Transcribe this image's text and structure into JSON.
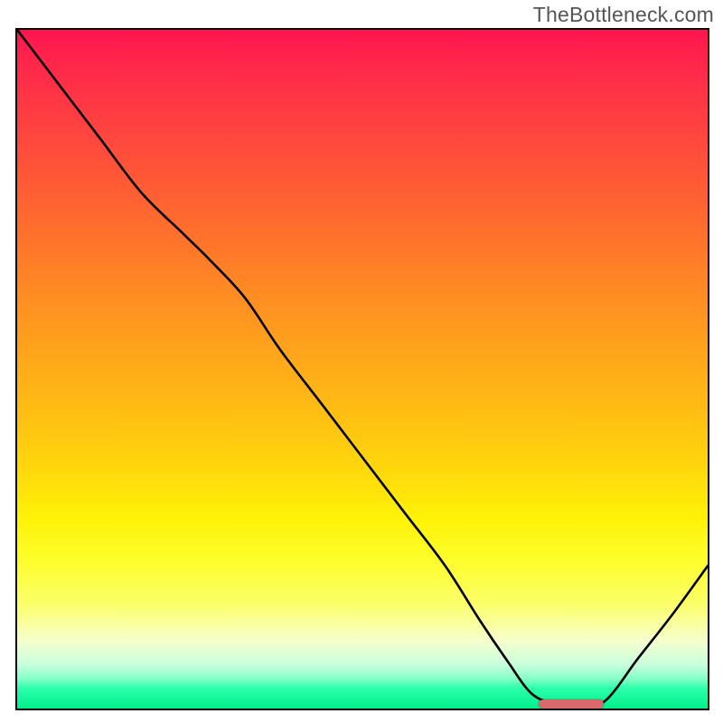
{
  "watermark": "TheBottleneck.com",
  "colors": {
    "border": "#000000",
    "curve": "#000000",
    "marker": "#d86a6e",
    "gradient_top": "#ff154f",
    "gradient_mid": "#fff207",
    "gradient_bottom": "#00ef8a"
  },
  "chart_data": {
    "type": "line",
    "title": "",
    "xlabel": "",
    "ylabel": "",
    "xlim": [
      0,
      100
    ],
    "ylim": [
      0,
      100
    ],
    "grid": false,
    "legend": false,
    "marker": {
      "x_start": 75.5,
      "x_end": 85,
      "y": 0.5
    },
    "series": [
      {
        "name": "bottleneck-curve",
        "x": [
          0,
          6,
          12,
          18,
          24,
          28,
          33,
          38,
          44,
          50,
          56,
          62,
          67,
          71,
          74.5,
          78,
          81,
          85,
          90,
          95,
          100
        ],
        "y": [
          100,
          92,
          84,
          76,
          70,
          66,
          60.5,
          53,
          45,
          37,
          29,
          21,
          13,
          7,
          2.2,
          0.7,
          0.6,
          1.0,
          7.5,
          14,
          21
        ]
      }
    ]
  }
}
